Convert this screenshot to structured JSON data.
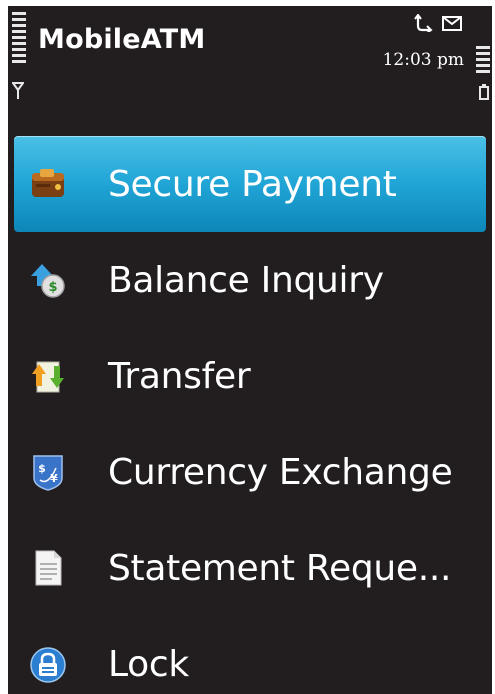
{
  "status_bar": {
    "app_title": "MobileATM",
    "time": "12:03 pm",
    "icons": [
      "signal-strength-icon",
      "antenna-icon",
      "call-forward-icon",
      "envelope-icon",
      "battery-level-icon",
      "battery-icon"
    ]
  },
  "menu": {
    "selected_index": 0,
    "items": [
      {
        "label": "Secure Payment",
        "icon": "wallet-icon"
      },
      {
        "label": "Balance Inquiry",
        "icon": "coin-upload-icon"
      },
      {
        "label": "Transfer",
        "icon": "transfer-icon"
      },
      {
        "label": "Currency Exchange",
        "icon": "currency-exchange-icon"
      },
      {
        "label": "Statement Reque...",
        "icon": "document-icon"
      },
      {
        "label": "Lock",
        "icon": "lock-icon"
      }
    ]
  },
  "colors": {
    "background": "#221e1f",
    "highlight": "#20a5d6",
    "text": "#ffffff"
  }
}
